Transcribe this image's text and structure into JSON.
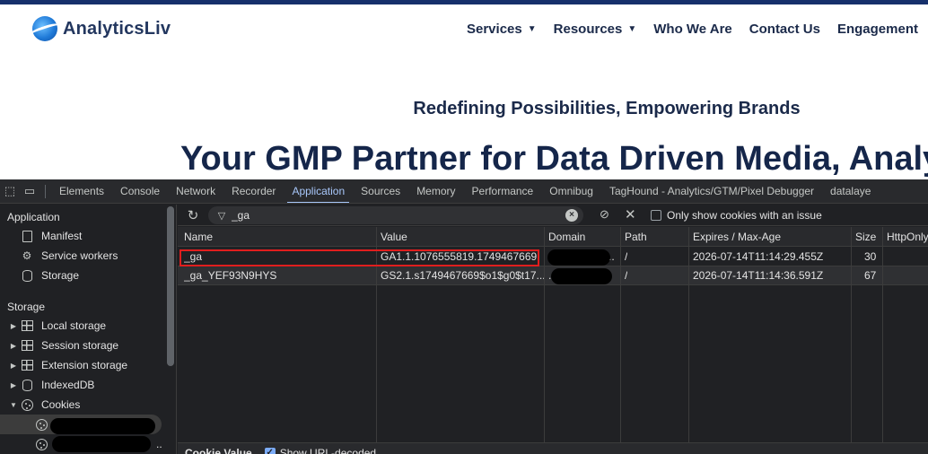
{
  "site": {
    "logo_text": "AnalyticsLiv",
    "nav": [
      "Services",
      "Resources",
      "Who We Are",
      "Contact Us",
      "Engagement"
    ],
    "tagline": "Redefining Possibilities, Empowering Brands",
    "headline": "Your GMP Partner for Data Driven Media, Analy"
  },
  "devtools": {
    "tabs": [
      "Elements",
      "Console",
      "Network",
      "Recorder",
      "Application",
      "Sources",
      "Memory",
      "Performance",
      "Omnibug",
      "TagHound - Analytics/GTM/Pixel Debugger",
      "datalaye"
    ],
    "active_tab": "Application",
    "sidebar": {
      "application_header": "Application",
      "app_items": [
        "Manifest",
        "Service workers",
        "Storage"
      ],
      "storage_header": "Storage",
      "storage_items": [
        "Local storage",
        "Session storage",
        "Extension storage",
        "IndexedDB",
        "Cookies"
      ],
      "cookie_children_suffix": ".."
    },
    "filter": {
      "value": "_ga",
      "only_issue_label": "Only show cookies with an issue"
    },
    "table": {
      "columns": [
        "Name",
        "Value",
        "Domain",
        "Path",
        "Expires / Max-Age",
        "Size",
        "HttpOnly"
      ],
      "rows": [
        {
          "name": "_ga",
          "value": "GA1.1.1076555819.1749467669",
          "domain_suffix": "..",
          "path": "/",
          "expires": "2026-07-14T11:14:29.455Z",
          "size": "30"
        },
        {
          "name": "_ga_YEF93N9HYS",
          "value": "GS2.1.s1749467669$o1$g0$t17...",
          "domain_suffix": ".",
          "path": "/",
          "expires": "2026-07-14T11:14:36.591Z",
          "size": "67"
        }
      ]
    },
    "footer": {
      "title": "Cookie Value",
      "show_decoded_label": "Show URL-decoded"
    }
  },
  "colors": {
    "accent": "#a8c7fa",
    "highlight": "#e01e1e",
    "brand": "#16306b"
  }
}
